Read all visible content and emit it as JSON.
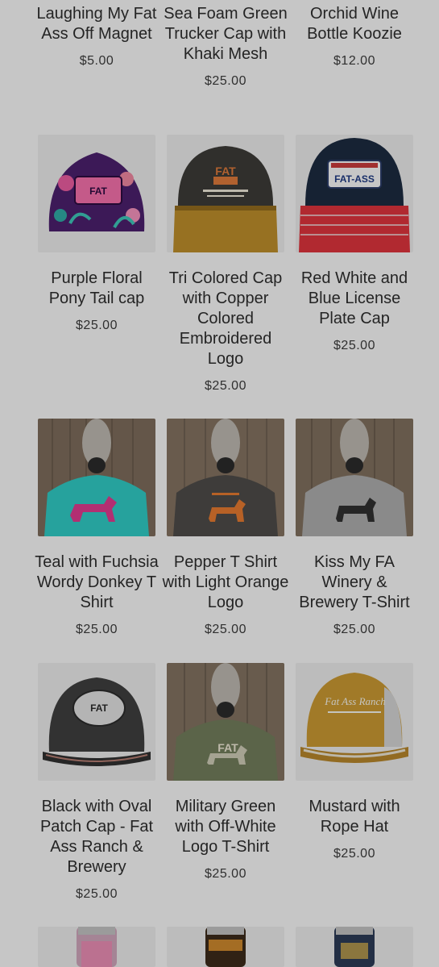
{
  "rows": [
    [
      {
        "title": "Laughing My Fat Ass Off Magnet",
        "price": "$5.00"
      },
      {
        "title": "Sea Foam Green Trucker Cap with Khaki Mesh",
        "price": "$25.00"
      },
      {
        "title": "Orchid Wine Bottle Koozie",
        "price": "$12.00"
      }
    ],
    [
      {
        "title": "Purple Floral Pony Tail cap",
        "price": "$25.00",
        "image_text": "FAT"
      },
      {
        "title": "Tri Colored Cap with Copper Colored Embroidered Logo",
        "price": "$25.00",
        "image_text": "FAT"
      },
      {
        "title": "Red White and Blue License Plate Cap",
        "price": "$25.00",
        "image_text": "FAT-ASS"
      }
    ],
    [
      {
        "title": "Teal with Fuchsia Wordy Donkey T Shirt",
        "price": "$25.00"
      },
      {
        "title": "Pepper T Shirt with Light Orange Logo",
        "price": "$25.00"
      },
      {
        "title": "Kiss My FA Winery & Brewery T-Shirt",
        "price": "$25.00"
      }
    ],
    [
      {
        "title": "Black with Oval Patch Cap - Fat Ass Ranch & Brewery",
        "price": "$25.00",
        "image_text": "FAT"
      },
      {
        "title": "Military Green with Off-White Logo T-Shirt",
        "price": "$25.00",
        "image_text": "FAT"
      },
      {
        "title": "Mustard with Rope Hat",
        "price": "$25.00",
        "image_text": "Fat Ass Ranch"
      }
    ]
  ],
  "colors": {
    "background": "#f2f2f2",
    "overlay": "rgba(0,0,0,0.18)",
    "text": "#2d2d2d"
  }
}
